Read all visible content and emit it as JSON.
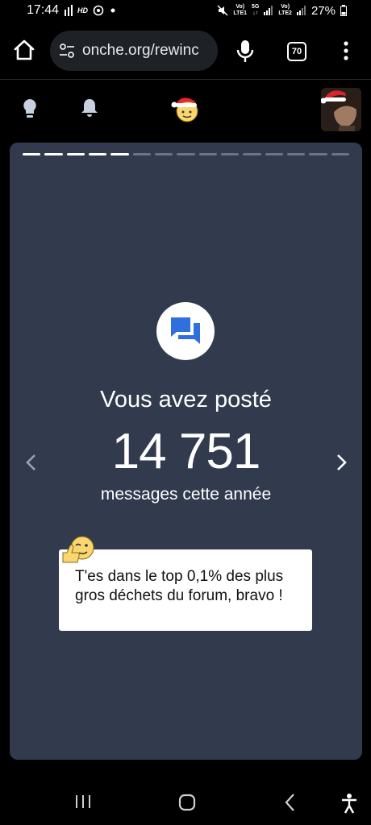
{
  "status_bar": {
    "time": "17:44",
    "hd_label": "HD",
    "volte1": "Vo)",
    "lte1": "LTE1",
    "net_5g": "5G",
    "volte2": "Vo)",
    "lte2": "LTE2",
    "battery": "27%"
  },
  "browser": {
    "url": "onche.org/rewinc",
    "tab_count": "70"
  },
  "card": {
    "progress_total": 15,
    "progress_done": 5,
    "headline": "Vous avez posté",
    "number": "14 751",
    "subline": "messages cette année",
    "bubble_text": "T'es dans le top 0,1% des plus gros déchets du forum, bravo !"
  },
  "colors": {
    "card_bg": "#323a4e",
    "accent_blue": "#2f6fe0",
    "page_bg": "#000000"
  },
  "icons": {
    "home": "home-icon",
    "site_settings": "tune-icon",
    "mic": "mic-icon",
    "menu": "more-vert-icon",
    "bulb": "lightbulb-icon",
    "bell": "bell-icon",
    "logo": "santa-smiley-icon",
    "chat": "forum-chat-icon",
    "prev": "chevron-left-icon",
    "next": "chevron-right-icon",
    "emoji": "thumbs-up-wink-emoji"
  }
}
